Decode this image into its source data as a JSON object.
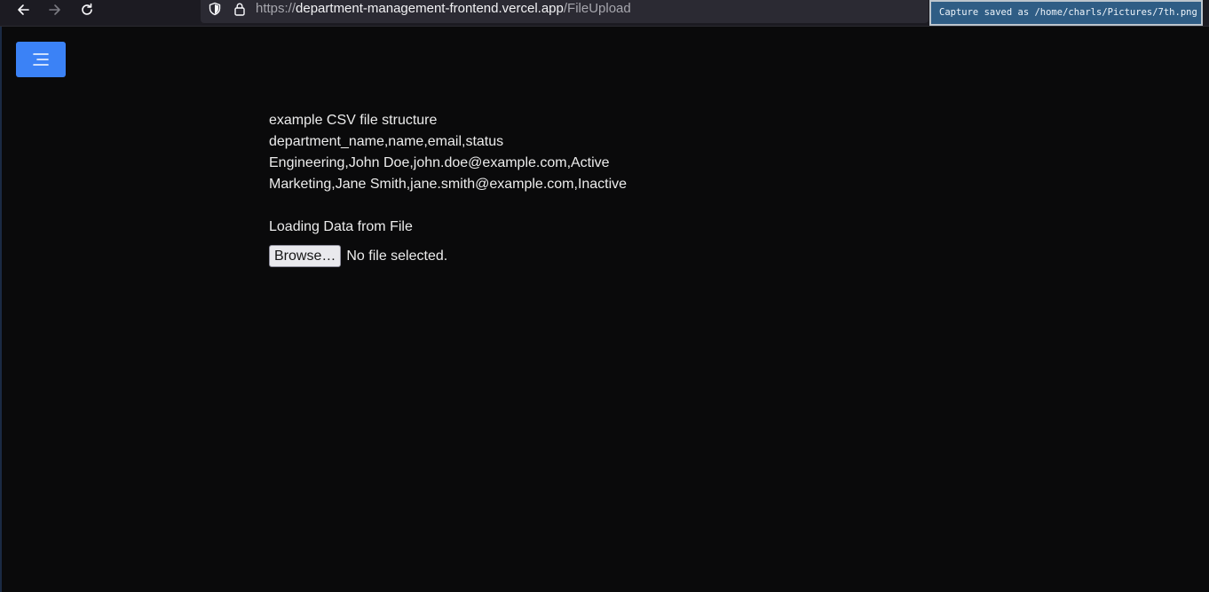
{
  "browser": {
    "url_scheme": "https://",
    "url_host": "department-management-frontend.vercel.app",
    "url_path": "/FileUpload",
    "notification": "Capture saved as /home/charls/Pictures/7th.png"
  },
  "page": {
    "lines": [
      "example CSV file structure",
      "department_name,name,email,status",
      "Engineering,John Doe,john.doe@example.com,Active",
      "Marketing,Jane Smith,jane.smith@example.com,Inactive"
    ],
    "loading_label": "Loading Data from File",
    "browse_label": "Browse…",
    "file_status": "No file selected."
  },
  "colors": {
    "background": "#0a0a0b",
    "menu_button": "#3b82f6",
    "notification": "#2f5d85"
  },
  "icons": [
    "back-arrow-icon",
    "forward-arrow-icon",
    "reload-icon",
    "shield-icon",
    "lock-icon",
    "hamburger-menu-icon"
  ]
}
